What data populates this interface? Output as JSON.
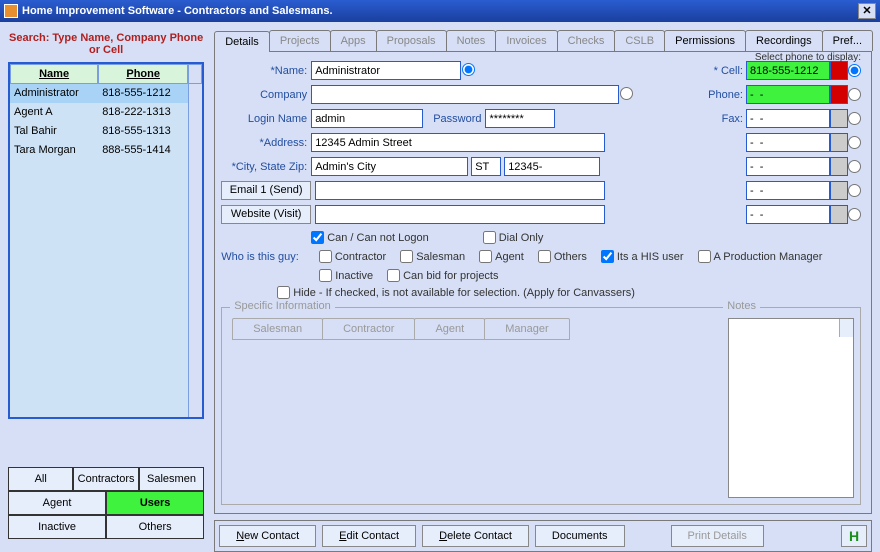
{
  "window": {
    "title": "Home Improvement Software - Contractors and Salesmans."
  },
  "search_label": "Search: Type Name, Company Phone or Cell",
  "list_headers": {
    "name": "Name",
    "phone": "Phone"
  },
  "contacts": [
    {
      "name": "Administrator",
      "phone": "818-555-1212",
      "selected": true
    },
    {
      "name": "Agent A",
      "phone": "818-222-1313",
      "selected": false
    },
    {
      "name": "Tal Bahir",
      "phone": "818-555-1313",
      "selected": false
    },
    {
      "name": "Tara Morgan",
      "phone": "888-555-1414",
      "selected": false
    }
  ],
  "filters": {
    "row1": [
      "All",
      "Contractors",
      "Salesmen"
    ],
    "row2": [
      "Agent",
      "Users"
    ],
    "row3": [
      "Inactive",
      "Others"
    ],
    "active": "Users"
  },
  "tabs": [
    "Details",
    "Projects",
    "Apps",
    "Proposals",
    "Notes",
    "Invoices",
    "Checks",
    "CSLB",
    "Permissions",
    "Recordings",
    "Pref..."
  ],
  "active_tab": "Details",
  "phone_display_label": "Select phone to display:",
  "labels": {
    "name": "Name:",
    "company": "Company",
    "login": "Login Name",
    "password": "Password",
    "address": "Address:",
    "csz": "City, State Zip:",
    "email1": "Email 1 (Send)",
    "website": "Website (Visit)",
    "cell": "Cell:",
    "phone": "Phone:",
    "fax": "Fax:"
  },
  "form": {
    "name": "Administrator",
    "company": "",
    "login": "admin",
    "password": "********",
    "address": "12345 Admin Street",
    "city": "Admin's City",
    "state": "ST",
    "zip": "12345-",
    "email1": "",
    "website": ""
  },
  "phones": {
    "cell": "818-555-1212",
    "phone": "-  -",
    "fax": "-  -",
    "extra1": "-  -",
    "extra2": "-  -",
    "extra3": "-  -",
    "extra4": "-  -"
  },
  "checks": {
    "can_logon": "Can / Can not Logon",
    "dial_only": "Dial Only",
    "who_label": "Who is this guy:",
    "contractor": "Contractor",
    "salesman": "Salesman",
    "agent": "Agent",
    "others": "Others",
    "his_user": "Its a HIS user",
    "prod_mgr": "A Production Manager",
    "inactive": "Inactive",
    "can_bid": "Can bid for projects",
    "hide": "Hide - If checked, is not available for selection. (Apply for Canvassers)"
  },
  "specific": {
    "legend": "Specific Information",
    "notes_legend": "Notes",
    "tabs": [
      "Salesman",
      "Contractor",
      "Agent",
      "Manager"
    ]
  },
  "bottom": {
    "new": "New Contact",
    "edit": "Edit Contact",
    "delete": "Delete Contact",
    "docs": "Documents",
    "print": "Print Details",
    "h": "H"
  }
}
